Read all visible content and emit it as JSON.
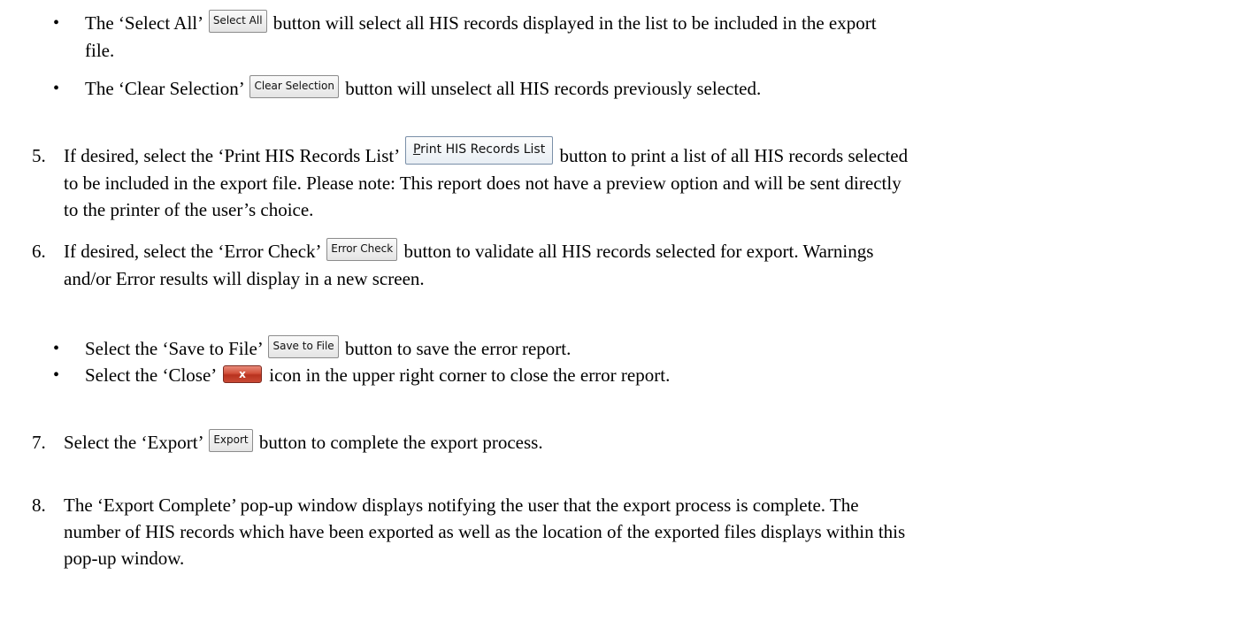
{
  "bullets_a": [
    {
      "before": "The ‘Select All’",
      "button": "Select All",
      "after": "button will select all HIS records displayed in the list to be included in the export",
      "cont": "file."
    },
    {
      "before": "The ‘Clear Selection’",
      "button": "Clear Selection",
      "after": "button will unselect all HIS records previously selected."
    }
  ],
  "step5": {
    "num": "5.",
    "before": "If desired, select the ‘Print HIS Records List’",
    "button_first": "P",
    "button_rest": "rint HIS Records List",
    "after": "button to print a list of all HIS records selected",
    "line2": "to be included in the export file. Please note: This report does not have a preview option and will be sent directly",
    "line3": "to the printer of the user’s choice."
  },
  "step6": {
    "num": "6.",
    "before": "If desired, select the ‘Error Check’",
    "button": "Error Check",
    "after": "button to validate all HIS records selected for export. Warnings",
    "line2": "and/or Error results will display in a new screen."
  },
  "bullets_b": [
    {
      "before": "Select the ‘Save to File’",
      "button": "Save to File",
      "after": "button to save the error report."
    },
    {
      "before": "Select the ‘Close’",
      "icon_glyph": "x",
      "after": "icon in the upper right corner to close the error report."
    }
  ],
  "step7": {
    "num": "7.",
    "before": "Select the ‘Export’",
    "button": "Export",
    "after": "button to complete the export process."
  },
  "step8": {
    "num": "8.",
    "line1": "The ‘Export Complete’ pop-up window displays notifying the user that the export process is complete. The",
    "line2": "number of HIS records which have been exported as well as the location of the exported files displays within this",
    "line3": "pop-up window."
  }
}
